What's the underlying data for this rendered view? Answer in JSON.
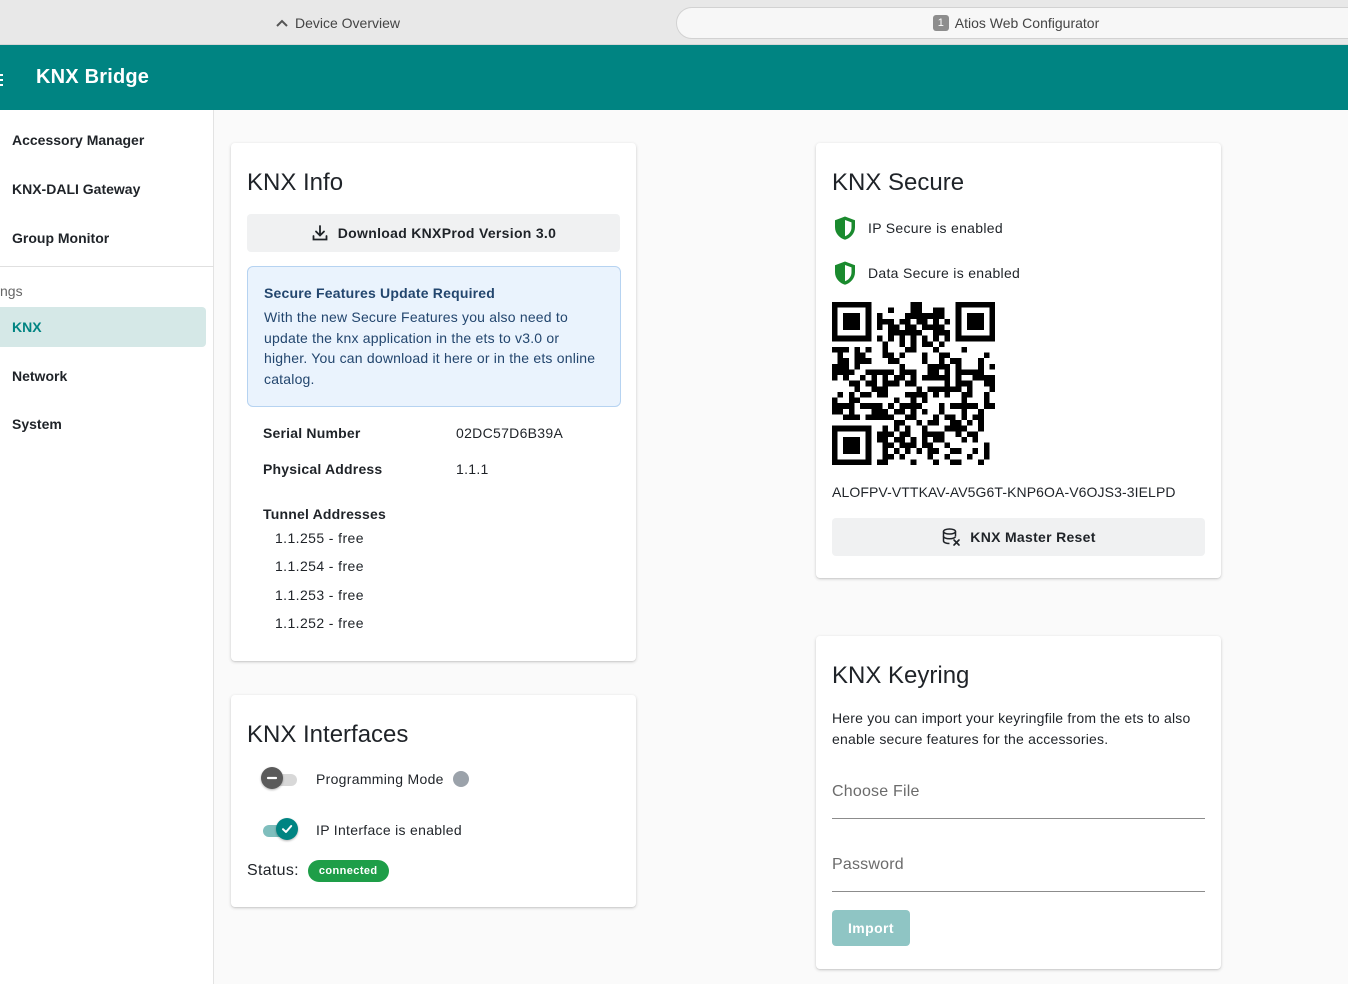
{
  "browser": {
    "tab_inactive_label": "Device Overview",
    "tab_active_label": "Atios Web Configurator",
    "tab_active_badge": "1"
  },
  "appbar": {
    "title": "KNX Bridge"
  },
  "sidebar": {
    "items": [
      {
        "label": "Accessory Manager"
      },
      {
        "label": "KNX-DALI Gateway"
      },
      {
        "label": "Group Monitor"
      }
    ],
    "section_label": "ngs",
    "settings_items": [
      {
        "label": "KNX",
        "active": true
      },
      {
        "label": "Network"
      },
      {
        "label": "System"
      }
    ]
  },
  "knx_info": {
    "title": "KNX Info",
    "download_label": "Download KNXProd Version 3.0",
    "alert_title": "Secure Features Update Required",
    "alert_body": "With the new Secure Features you also need to update the knx application in the ets to v3.0 or higher. You can download it here or in the ets online catalog.",
    "serial_label": "Serial Number",
    "serial_value": "02DC57D6B39A",
    "physical_label": "Physical Address",
    "physical_value": "1.1.1",
    "tunnel_label": "Tunnel Addresses",
    "tunnels": [
      "1.1.255 - free",
      "1.1.254 - free",
      "1.1.253 - free",
      "1.1.252 - free"
    ]
  },
  "knx_interfaces": {
    "title": "KNX Interfaces",
    "programming_label": "Programming Mode",
    "programming_on": false,
    "ip_label": "IP Interface is enabled",
    "ip_on": true,
    "status_label": "Status:",
    "status_value": "connected"
  },
  "knx_secure": {
    "title": "KNX Secure",
    "ip_secure_label": "IP Secure is enabled",
    "data_secure_label": "Data Secure is enabled",
    "key_text": "ALOFPV-VTTKAV-AV5G6T-KNP6OA-V6OJS3-3IELPD",
    "reset_label": "KNX Master Reset"
  },
  "knx_keyring": {
    "title": "KNX Keyring",
    "description": "Here you can import your keyringfile from the ets to also enable secure features for the accessories.",
    "file_placeholder": "Choose File",
    "password_placeholder": "Password",
    "import_label": "Import"
  },
  "colors": {
    "primary": "#008482",
    "active_nav_bg": "#d5e8e7",
    "success": "#1e9e48",
    "shield": "#1a8a2e"
  },
  "icons": [
    "chevron-up-icon",
    "menu-icon",
    "download-icon",
    "shield-icon",
    "database-reset-icon",
    "check-icon",
    "minus-icon"
  ]
}
